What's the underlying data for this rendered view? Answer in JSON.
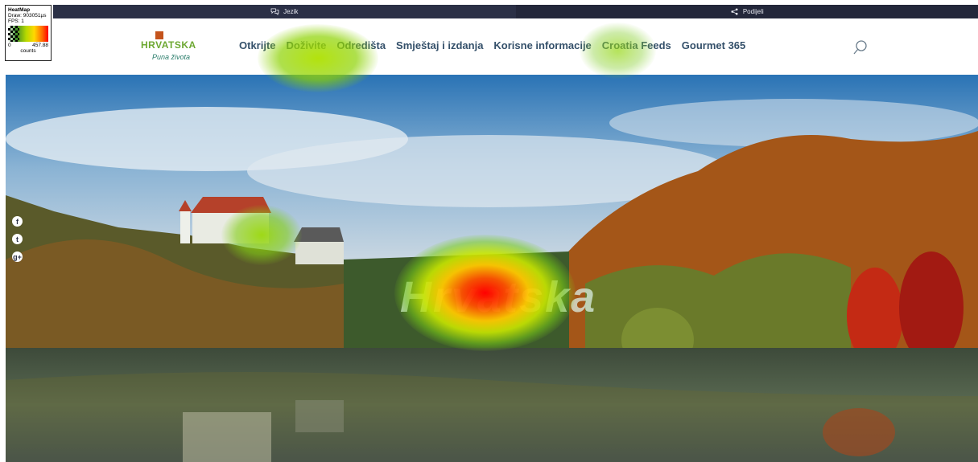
{
  "heatmap_legend": {
    "title": "HeatMap",
    "draw": "Draw: 903051µs",
    "fps": "FPS: 1",
    "min": "0",
    "max": "457.88",
    "unit": "counts"
  },
  "topbar": {
    "language_label": "Jezik",
    "share_label": "Podijeli"
  },
  "logo": {
    "brand": "HRVATSKA",
    "tagline": "Puna života"
  },
  "nav": {
    "items": [
      "Otkrijte",
      "Doživite",
      "Odredišta",
      "Smještaj i izdanja",
      "Korisne informacije",
      "Croatia Feeds",
      "Gourmet 365"
    ]
  },
  "hero": {
    "title": "Hrvatska"
  },
  "social": [
    "f",
    "t",
    "g+"
  ],
  "colors": {
    "topbar": "#2b3046",
    "nav_text": "#34506a",
    "brand_green": "#6da832"
  }
}
